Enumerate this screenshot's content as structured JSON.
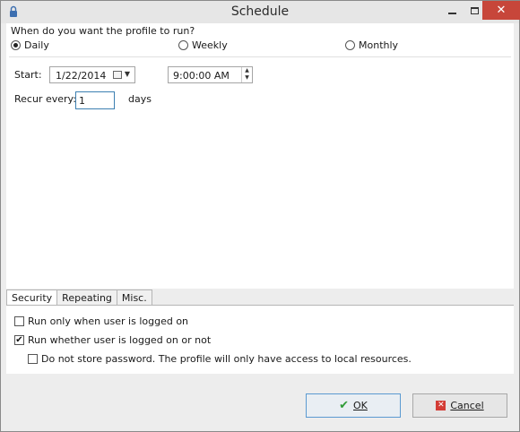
{
  "window": {
    "title": "Schedule",
    "close_glyph": "✕"
  },
  "frequency": {
    "question": "When do you want the profile to run?",
    "options": [
      {
        "label": "Daily",
        "selected": true
      },
      {
        "label": "Weekly",
        "selected": false
      },
      {
        "label": "Monthly",
        "selected": false
      }
    ]
  },
  "daily": {
    "start_label": "Start:",
    "start_date": "1/22/2014",
    "start_time": "9:00:00 AM",
    "recur_label": "Recur every:",
    "recur_value": "1",
    "recur_unit": "days"
  },
  "tabs": [
    {
      "label": "Security",
      "active": true
    },
    {
      "label": "Repeating",
      "active": false
    },
    {
      "label": "Misc.",
      "active": false
    }
  ],
  "security": {
    "options": [
      {
        "label": "Run only when user is logged on",
        "checked": false
      },
      {
        "label": "Run whether user is logged on or not",
        "checked": true
      },
      {
        "label": "Do not store password. The profile will only have access to local resources.",
        "checked": false
      }
    ],
    "check_glyph": "✔"
  },
  "buttons": {
    "ok_label": "OK",
    "cancel_label": "Cancel"
  },
  "icons": {
    "app": "lock-icon",
    "minimize": "minimize-icon",
    "maximize": "maximize-icon",
    "close": "close-icon",
    "calendar": "calendar-icon",
    "dropdown": "chevron-down-icon",
    "spin_up": "chevron-up-icon",
    "spin_down": "chevron-down-icon",
    "ok": "checkmark-icon",
    "cancel": "cancel-icon"
  },
  "colors": {
    "close_button": "#c7463a",
    "ok_check": "#2f9b36",
    "cancel_icon": "#d33c35",
    "focus_border": "#3c7fb1"
  }
}
